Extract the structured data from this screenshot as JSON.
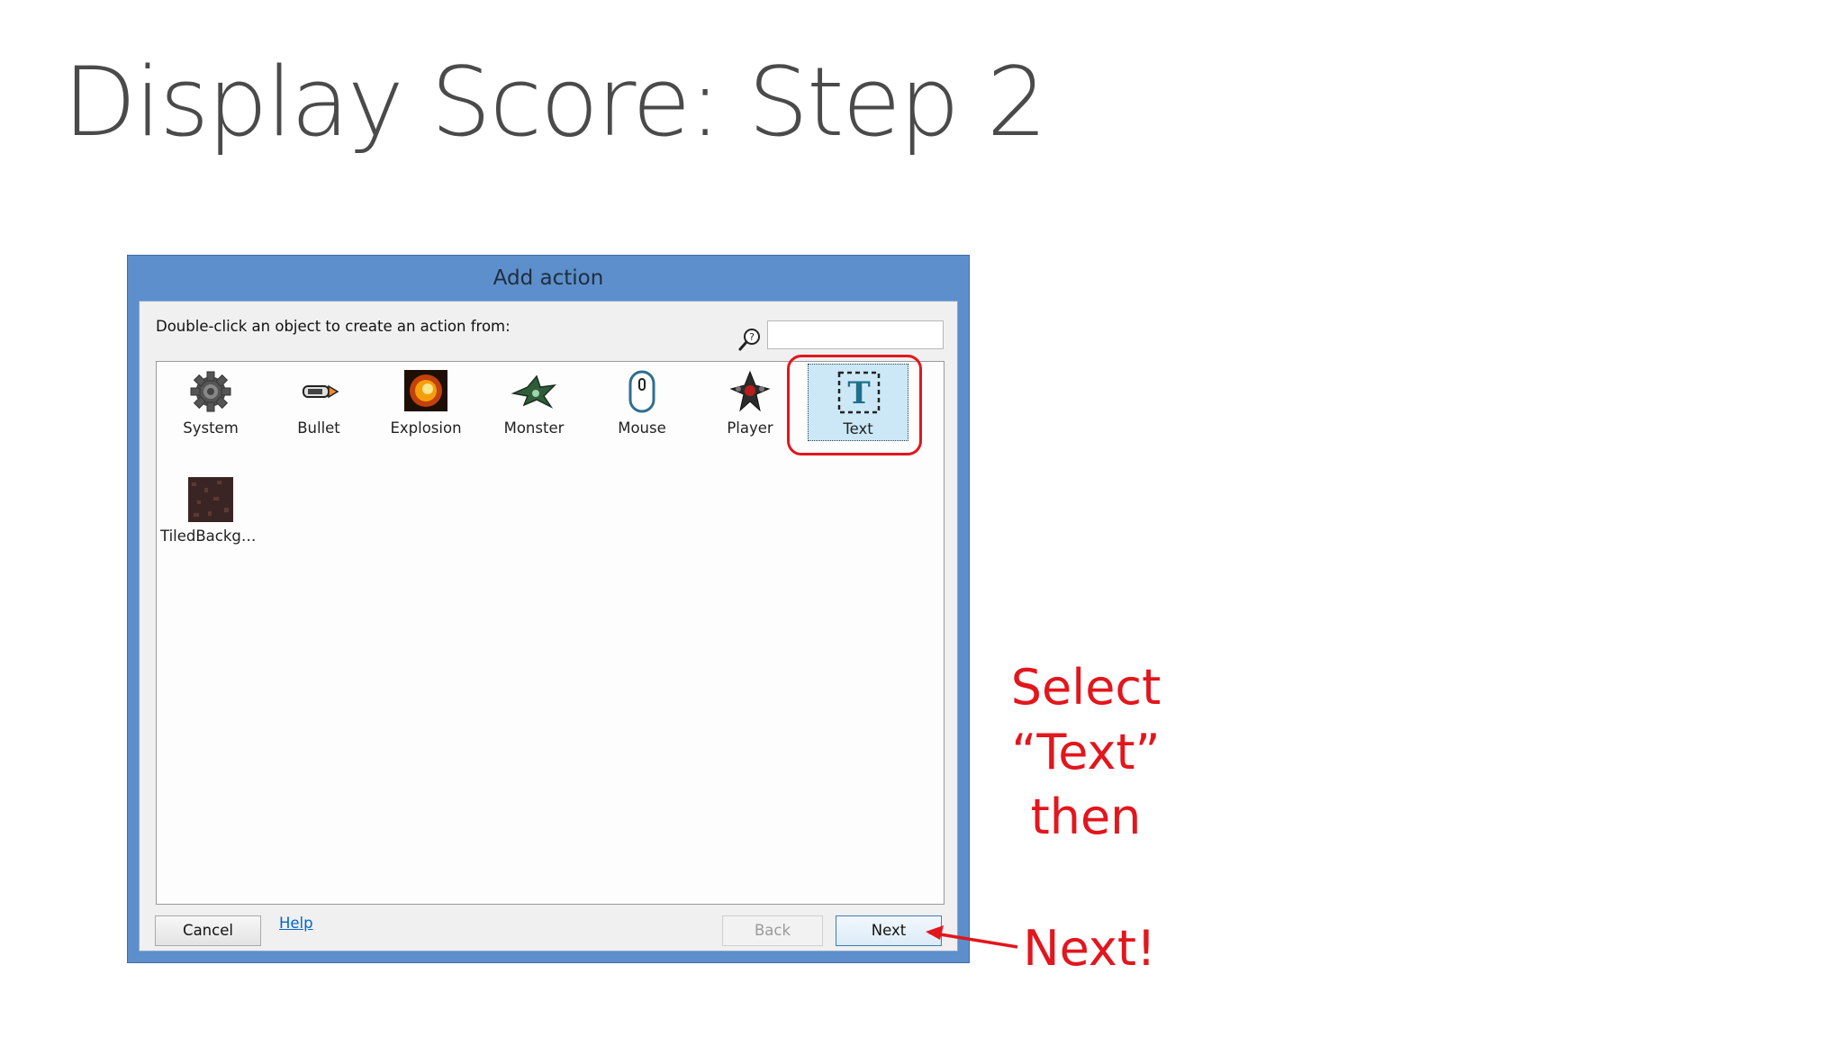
{
  "slide": {
    "title": "Display Score: Step 2"
  },
  "dialog": {
    "title": "Add action",
    "instruction": "Double-click an object to create an action from:",
    "search": {
      "value": "",
      "placeholder": ""
    },
    "objects": [
      {
        "label": "System",
        "icon": "gear-icon"
      },
      {
        "label": "Bullet",
        "icon": "bullet-icon"
      },
      {
        "label": "Explosion",
        "icon": "explosion-icon"
      },
      {
        "label": "Monster",
        "icon": "monster-icon"
      },
      {
        "label": "Mouse",
        "icon": "mouse-icon"
      },
      {
        "label": "Player",
        "icon": "player-icon"
      },
      {
        "label": "Text",
        "icon": "text-object-icon",
        "selected": true
      },
      {
        "label": "TiledBackgr…",
        "icon": "tiled-background-icon"
      }
    ],
    "buttons": {
      "cancel": "Cancel",
      "help": "Help",
      "back": "Back",
      "next": "Next"
    }
  },
  "annotations": {
    "select_line1": "Select",
    "select_line2": "“Text”",
    "select_line3": "then",
    "next": "Next!",
    "color": "#e2161d"
  }
}
